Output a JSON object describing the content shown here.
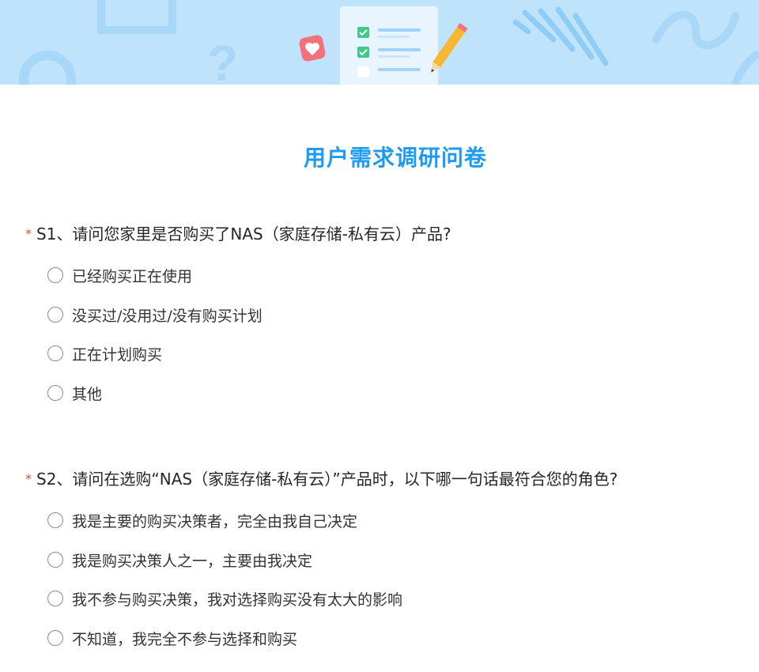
{
  "survey": {
    "title": "用户需求调研问卷",
    "required_mark": "*"
  },
  "questions": [
    {
      "label": "S1、请问您家里是否购买了NAS（家庭存储-私有云）产品?",
      "options": [
        "已经购买正在使用",
        "没买过/没用过/没有购买计划",
        "正在计划购买",
        "其他"
      ]
    },
    {
      "label": "S2、请问在选购“NAS（家庭存储-私有云）”产品时，以下哪一句话最符合您的角色?",
      "options": [
        "我是主要的购买决策者，完全由我自己决定",
        "我是购买决策人之一，主要由我决定",
        "我不参与购买决策，我对选择购买没有太大的影响",
        "不知道，我完全不参与选择和购买"
      ]
    }
  ],
  "colors": {
    "banner_bg": "#bfe3fb",
    "title": "#1e9bf0",
    "required": "#e8453c",
    "text": "#262626"
  }
}
